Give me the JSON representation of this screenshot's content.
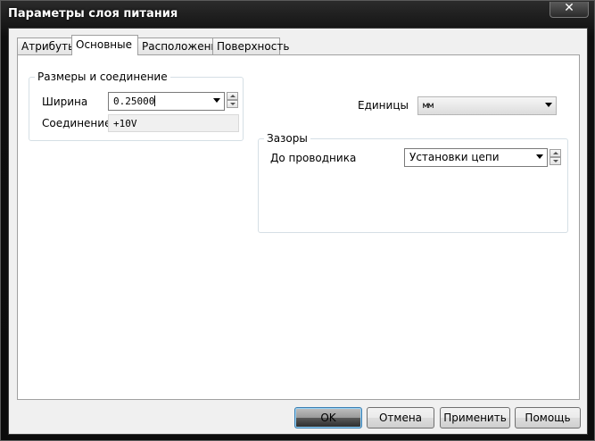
{
  "window": {
    "title": "Параметры слоя питания",
    "close_label": "✕"
  },
  "tabs": [
    {
      "label": "Атрибуты",
      "active": false
    },
    {
      "label": "Основные",
      "active": true
    },
    {
      "label": "Расположение",
      "active": false
    },
    {
      "label": "Поверхность",
      "active": false
    }
  ],
  "size_group": {
    "legend": "Размеры и соединение",
    "width_label": "Ширина",
    "width_value": "0.25000",
    "connection_label": "Соединение",
    "connection_value": "+10V"
  },
  "units": {
    "label": "Единицы",
    "value": "мм"
  },
  "clearance_group": {
    "legend": "Зазоры",
    "to_conductor_label": "До проводника",
    "to_conductor_value": "Установки цепи"
  },
  "buttons": {
    "ok": "OK",
    "cancel": "Отмена",
    "apply": "Применить",
    "help": "Помощь"
  }
}
